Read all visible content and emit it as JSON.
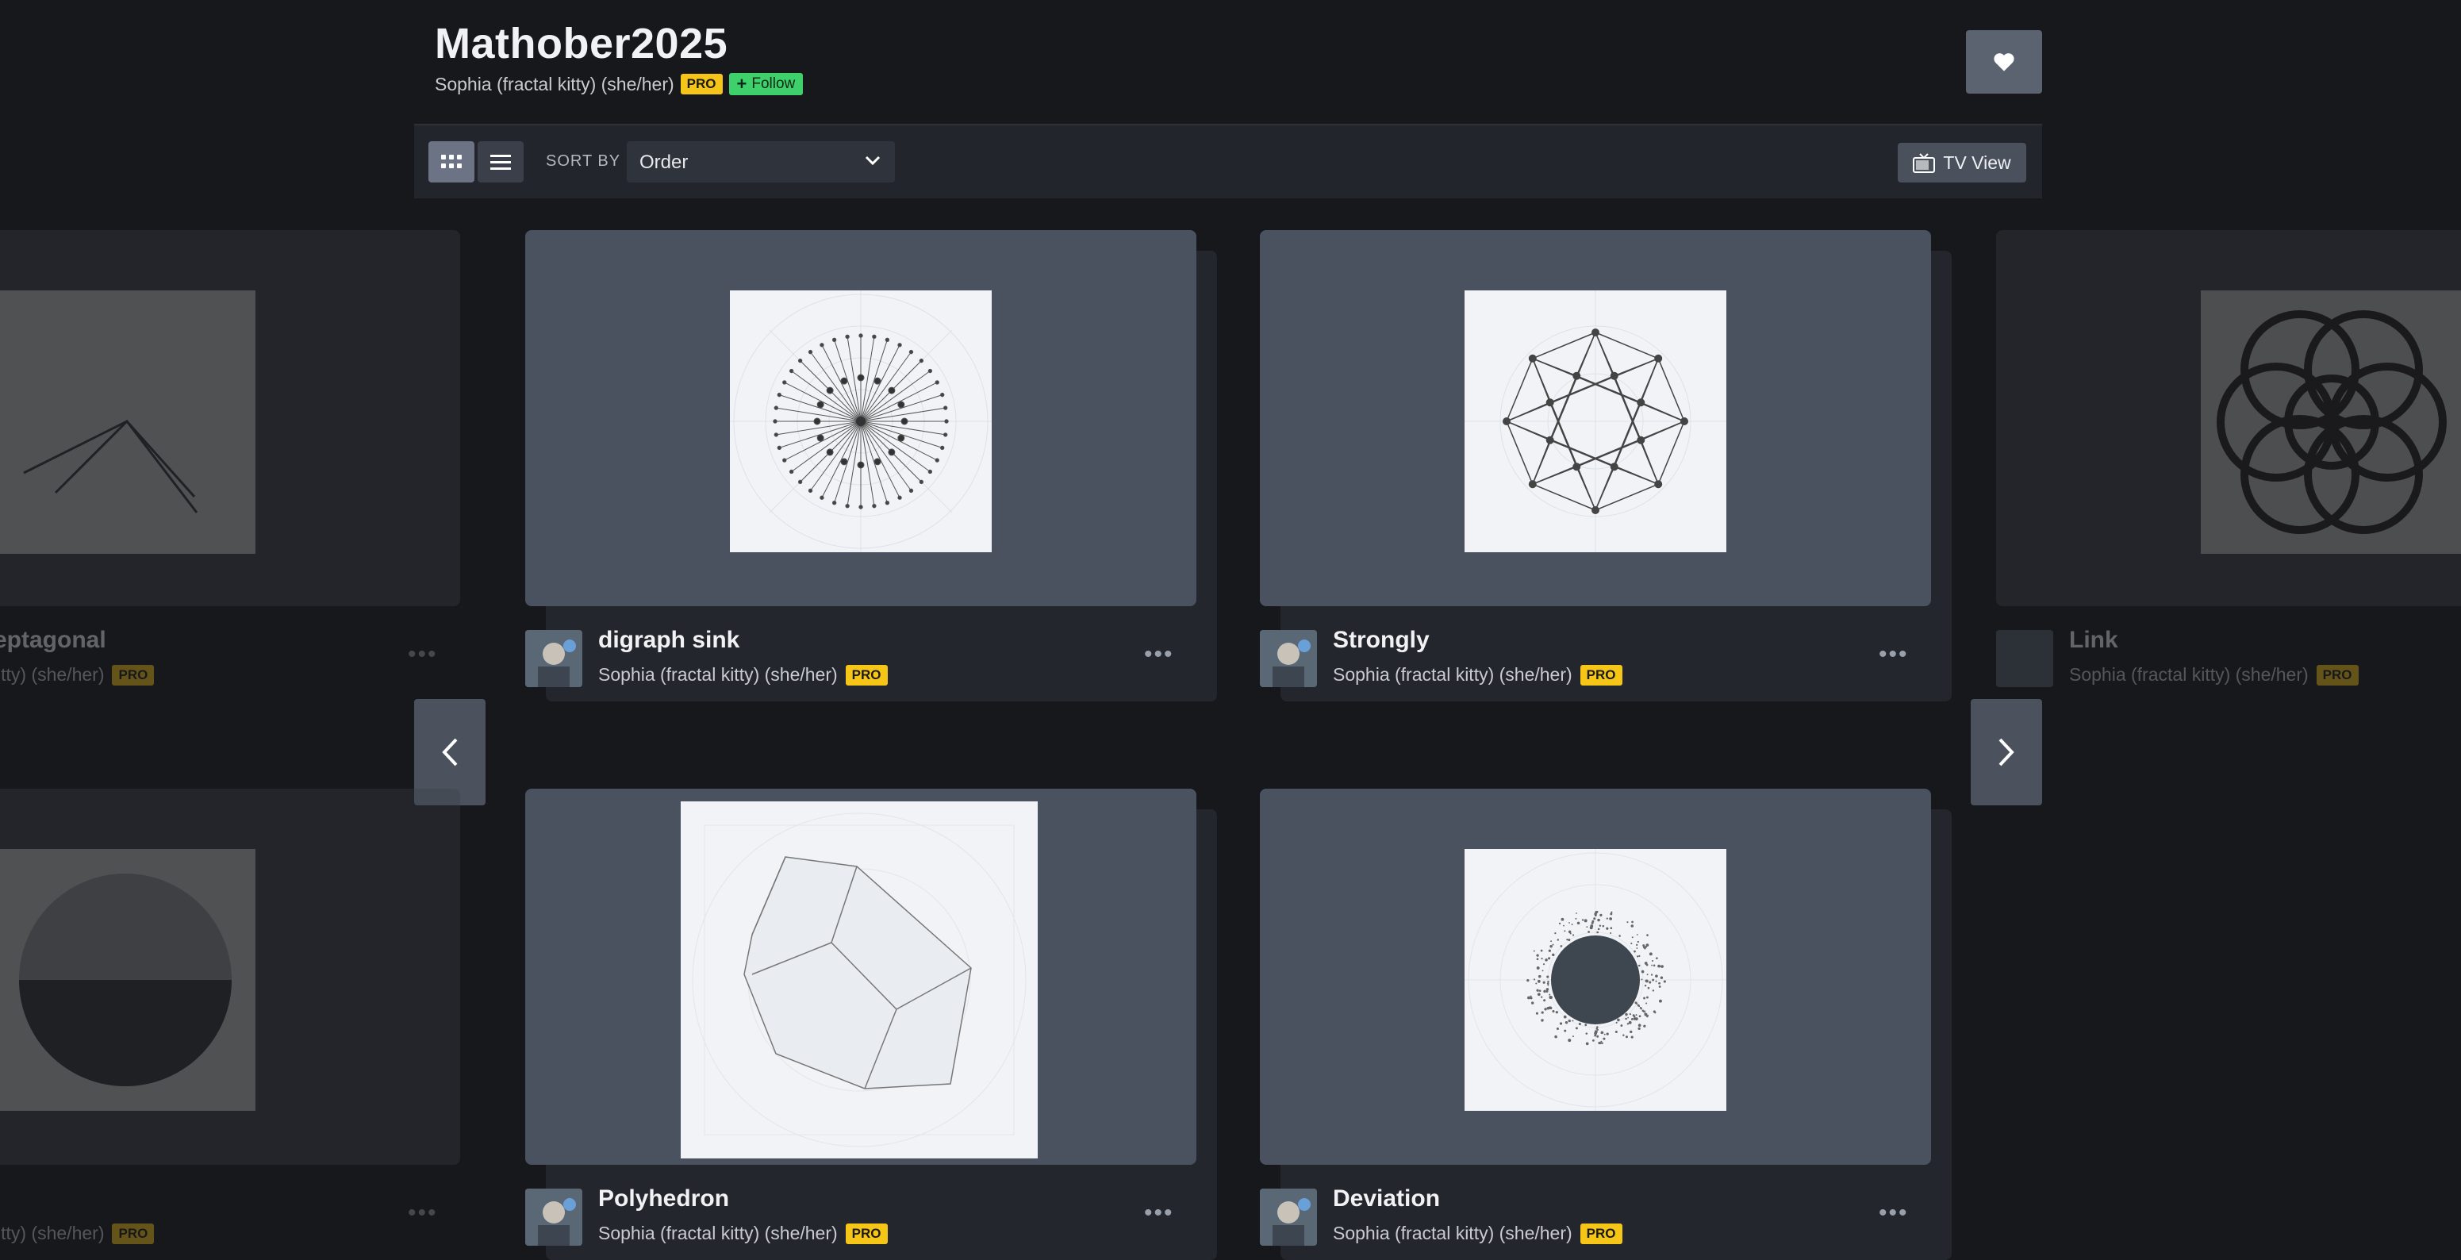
{
  "page": {
    "title": "Mathober2025",
    "owner": "Sophia (fractal kitty) (she/her)",
    "pro_badge": "PRO",
    "follow_label": "Follow"
  },
  "toolbar": {
    "sort_label": "SORT BY",
    "sort_value": "Order",
    "tv_view_label": "TV View"
  },
  "cards": [
    {
      "title": "eptagonal",
      "author": "itty) (she/her)",
      "badge": "PRO",
      "state": "faded-left"
    },
    {
      "title": "digraph sink",
      "author": "Sophia (fractal kitty) (she/her)",
      "badge": "PRO",
      "state": "active"
    },
    {
      "title": "Strongly",
      "author": "Sophia (fractal kitty) (she/her)",
      "badge": "PRO",
      "state": "active"
    },
    {
      "title": "Link",
      "author": "Sophia (fractal kitty) (she/her)",
      "badge": "PRO",
      "state": "faded-right"
    },
    {
      "title": "",
      "author": "itty) (she/her)",
      "badge": "PRO",
      "state": "faded-left"
    },
    {
      "title": "Polyhedron",
      "author": "Sophia (fractal kitty) (she/her)",
      "badge": "PRO",
      "state": "active"
    },
    {
      "title": "Deviation",
      "author": "Sophia (fractal kitty) (she/her)",
      "badge": "PRO",
      "state": "active"
    }
  ],
  "icons": {
    "heart": "heart-icon",
    "grid": "grid-view-icon",
    "list": "list-view-icon",
    "tv": "tv-icon",
    "prev": "chevron-left-icon",
    "next": "chevron-right-icon"
  },
  "colors": {
    "background": "#17181c",
    "pro_badge": "#f5c518",
    "follow": "#3ed06a",
    "card": "#4a5260"
  }
}
